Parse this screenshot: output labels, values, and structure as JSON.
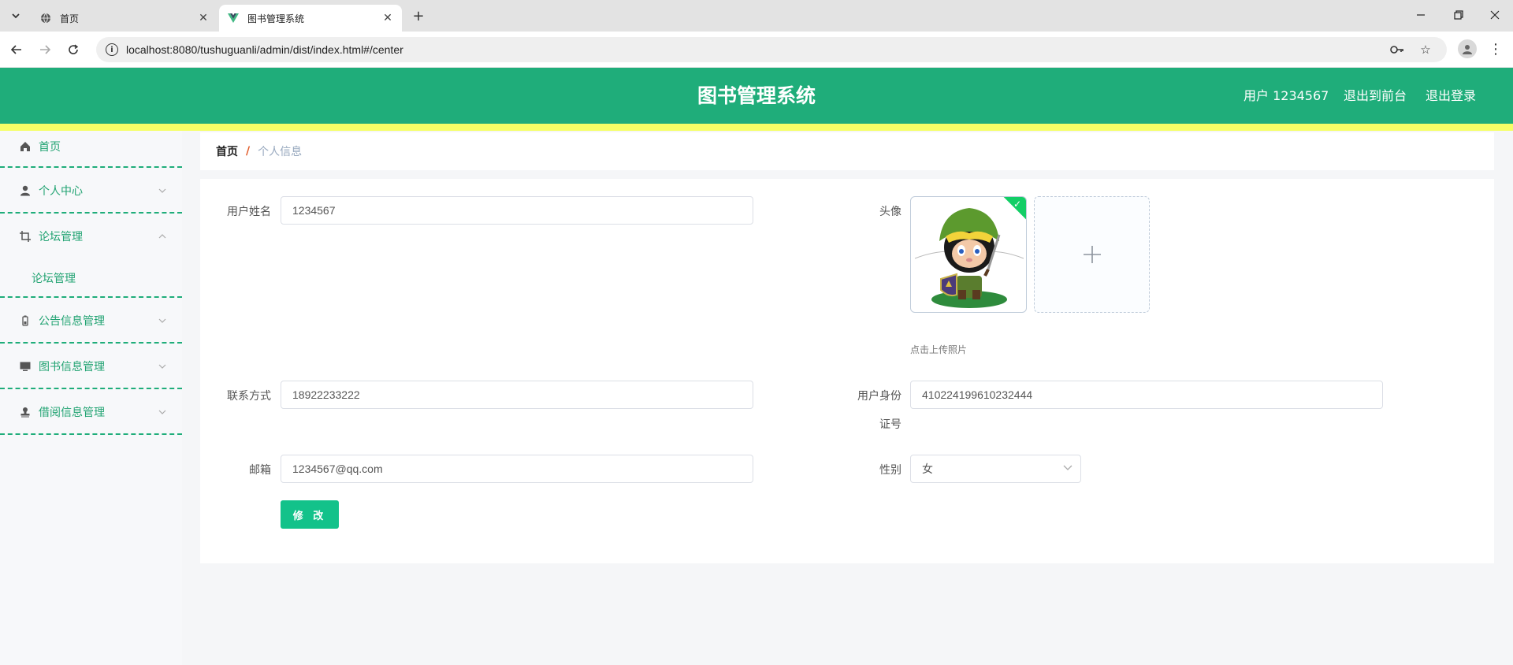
{
  "browser": {
    "tabs": [
      {
        "title": "首页",
        "active": false
      },
      {
        "title": "图书管理系统",
        "active": true
      }
    ],
    "url": "localhost:8080/tushuguanli/admin/dist/index.html#/center"
  },
  "header": {
    "title": "图书管理系统",
    "user_label": "用户 1234567",
    "back_to_front": "退出到前台",
    "logout": "退出登录",
    "colors": {
      "brand": "#1fad7a",
      "accent_strip": "#f5ff66"
    }
  },
  "sidebar": {
    "items": [
      {
        "label": "首页",
        "icon": "home-icon"
      },
      {
        "label": "个人中心",
        "icon": "user-icon",
        "expanded": false
      },
      {
        "label": "论坛管理",
        "icon": "crop-icon",
        "expanded": true,
        "children": [
          "论坛管理"
        ]
      },
      {
        "label": "公告信息管理",
        "icon": "battery-icon",
        "expanded": false
      },
      {
        "label": "图书信息管理",
        "icon": "monitor-icon",
        "expanded": false
      },
      {
        "label": "借阅信息管理",
        "icon": "stamp-icon",
        "expanded": false
      }
    ]
  },
  "breadcrumb": {
    "home": "首页",
    "separator": "/",
    "current": "个人信息"
  },
  "form": {
    "username_label": "用户姓名",
    "username_value": "1234567",
    "avatar_label": "头像",
    "upload_tip": "点击上传照片",
    "phone_label": "联系方式",
    "phone_value": "18922233222",
    "idcard_label": "用户身份证号",
    "idcard_label_line1": "用户身份",
    "idcard_label_line2": "证号",
    "idcard_value": "410224199610232444",
    "email_label": "邮箱",
    "email_value": "1234567@qq.com",
    "gender_label": "性别",
    "gender_value": "女",
    "submit_label": "修 改"
  }
}
